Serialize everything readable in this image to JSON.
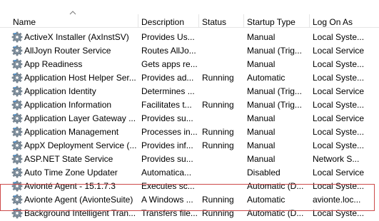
{
  "columns": {
    "name": "Name",
    "description": "Description",
    "status": "Status",
    "startup_type": "Startup Type",
    "log_on_as": "Log On As"
  },
  "icons": {
    "service": "gear-icon",
    "sort": "sort-ascending-icon"
  },
  "colors": {
    "highlight_border": "#cd4a4a"
  },
  "services": [
    {
      "name": "ActiveX Installer (AxInstSV)",
      "description": "Provides Us...",
      "status": "",
      "startup_type": "Manual",
      "log_on_as": "Local Syste..."
    },
    {
      "name": "AllJoyn Router Service",
      "description": "Routes AllJo...",
      "status": "",
      "startup_type": "Manual (Trig...",
      "log_on_as": "Local Service"
    },
    {
      "name": "App Readiness",
      "description": "Gets apps re...",
      "status": "",
      "startup_type": "Manual",
      "log_on_as": "Local Syste..."
    },
    {
      "name": "Application Host Helper Ser...",
      "description": "Provides ad...",
      "status": "Running",
      "startup_type": "Automatic",
      "log_on_as": "Local Syste..."
    },
    {
      "name": "Application Identity",
      "description": "Determines ...",
      "status": "",
      "startup_type": "Manual (Trig...",
      "log_on_as": "Local Service"
    },
    {
      "name": "Application Information",
      "description": "Facilitates t...",
      "status": "Running",
      "startup_type": "Manual (Trig...",
      "log_on_as": "Local Syste..."
    },
    {
      "name": "Application Layer Gateway ...",
      "description": "Provides su...",
      "status": "",
      "startup_type": "Manual",
      "log_on_as": "Local Service"
    },
    {
      "name": "Application Management",
      "description": "Processes in...",
      "status": "Running",
      "startup_type": "Manual",
      "log_on_as": "Local Syste..."
    },
    {
      "name": "AppX Deployment Service (...",
      "description": "Provides inf...",
      "status": "Running",
      "startup_type": "Manual",
      "log_on_as": "Local Syste..."
    },
    {
      "name": "ASP.NET State Service",
      "description": "Provides su...",
      "status": "",
      "startup_type": "Manual",
      "log_on_as": "Network S..."
    },
    {
      "name": "Auto Time Zone Updater",
      "description": "Automatica...",
      "status": "",
      "startup_type": "Disabled",
      "log_on_as": "Local Service"
    },
    {
      "name": "Avionté Agent - 15.1.7.3",
      "description": "Executes sc...",
      "status": "",
      "startup_type": "Automatic (D...",
      "log_on_as": "Local Syste..."
    },
    {
      "name": "Avionte Agent (AvionteSuite)",
      "description": "A Windows ...",
      "status": "Running",
      "startup_type": "Automatic",
      "log_on_as": "avionte.loc..."
    },
    {
      "name": "Background Intelligent Tran...",
      "description": "Transfers file...",
      "status": "Running",
      "startup_type": "Automatic (D...",
      "log_on_as": "Local Syste..."
    }
  ]
}
